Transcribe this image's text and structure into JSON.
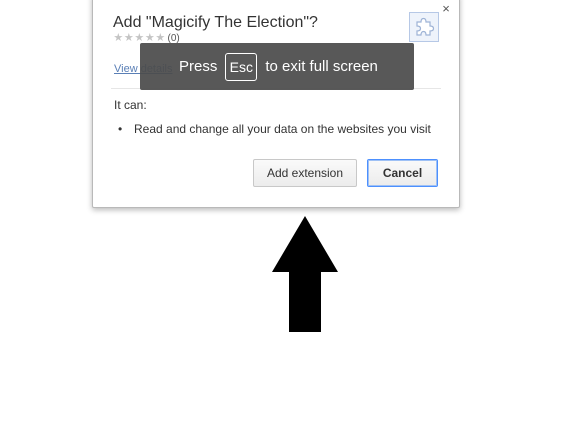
{
  "dialog": {
    "title": "Add \"Magicify The Election\"?",
    "rating_count": "(0)",
    "stars": 5,
    "view_details": "View details",
    "close_symbol": "×",
    "it_can": "It can:",
    "permissions": [
      "Read and change all your data on the websites you visit"
    ],
    "bullet": "•",
    "add_button": "Add extension",
    "cancel_button": "Cancel",
    "icon": "puzzle-piece-icon"
  },
  "toast": {
    "press": "Press",
    "key": "Esc",
    "rest": "to exit full screen"
  },
  "arrow": {
    "icon": "up-arrow-icon",
    "color": "#000000"
  }
}
